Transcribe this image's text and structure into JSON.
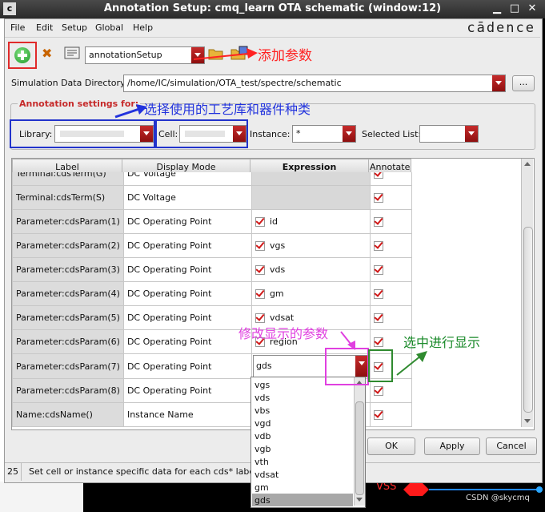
{
  "window": {
    "title": "Annotation Setup: cmq_learn OTA schematic (window:12)"
  },
  "menus": {
    "file": "File",
    "edit": "Edit",
    "setup": "Setup",
    "global": "Global",
    "help": "Help"
  },
  "brand": "cādence",
  "toolbar": {
    "setup_value": "annotationSetup"
  },
  "sim_dir": {
    "label": "Simulation Data Directory:",
    "value": "/home/IC/simulation/OTA_test/spectre/schematic",
    "browse": "..."
  },
  "settings": {
    "title": "Annotation settings for:",
    "library_label": "Library:",
    "cell_label": "Cell:",
    "instance_label": "Instance:",
    "instance_value": "*",
    "selected_list_label": "Selected List:"
  },
  "grid": {
    "headers": [
      "Label",
      "Display Mode",
      "Expression",
      "Annotate"
    ],
    "rows": [
      {
        "label": "Terminal:cdsTerm(G)",
        "mode": "DC Voltage",
        "expr": ""
      },
      {
        "label": "Terminal:cdsTerm(S)",
        "mode": "DC Voltage",
        "expr": ""
      },
      {
        "label": "Parameter:cdsParam(1)",
        "mode": "DC Operating Point",
        "expr": "id"
      },
      {
        "label": "Parameter:cdsParam(2)",
        "mode": "DC Operating Point",
        "expr": "vgs"
      },
      {
        "label": "Parameter:cdsParam(3)",
        "mode": "DC Operating Point",
        "expr": "vds"
      },
      {
        "label": "Parameter:cdsParam(4)",
        "mode": "DC Operating Point",
        "expr": "gm"
      },
      {
        "label": "Parameter:cdsParam(5)",
        "mode": "DC Operating Point",
        "expr": "vdsat"
      },
      {
        "label": "Parameter:cdsParam(6)",
        "mode": "DC Operating Point",
        "expr": "region"
      },
      {
        "label": "Parameter:cdsParam(7)",
        "mode": "DC Operating Point",
        "expr": "gds"
      },
      {
        "label": "Parameter:cdsParam(8)",
        "mode": "DC Operating Point",
        "expr": ""
      },
      {
        "label": "Name:cdsName()",
        "mode": "Instance Name",
        "expr": ""
      }
    ]
  },
  "dropdown_options": [
    "vgs",
    "vds",
    "vbs",
    "vgd",
    "vdb",
    "vgb",
    "vth",
    "vdsat",
    "gm",
    "gds"
  ],
  "buttons": {
    "ok": "OK",
    "apply": "Apply",
    "cancel": "Cancel"
  },
  "status": {
    "number": "25",
    "message": "Set cell or instance specific data for each cds* label"
  },
  "background": {
    "vss_label": "VSS",
    "watermark": "CSDN @skycmq"
  },
  "annotations": {
    "add_param": "添加参数",
    "choose_lib": "选择使用的工艺库和器件种类",
    "modify_param": "修改显示的参数",
    "select_display": "选中进行显示"
  },
  "colors": {
    "accent_red": "#c62b2b",
    "anno_red": "#ff2222",
    "anno_blue": "#2233dd",
    "anno_magenta": "#e040e0",
    "anno_green": "#1a8a2a"
  }
}
